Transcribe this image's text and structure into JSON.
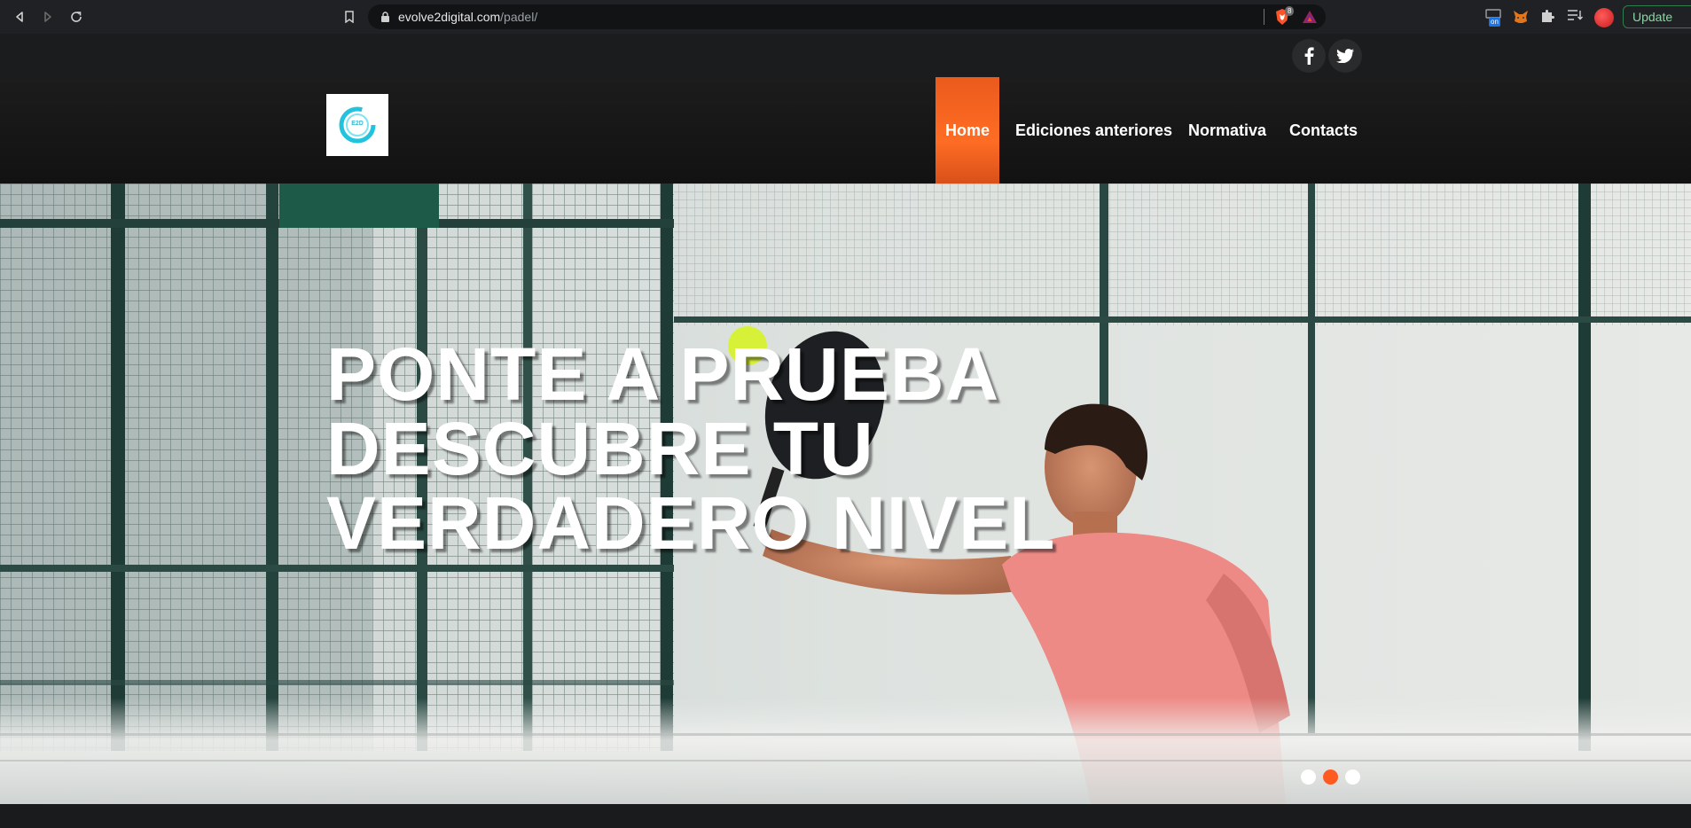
{
  "browser": {
    "url_domain": "evolve2digital.com",
    "url_path": "/padel/",
    "brave_badge_count": "8",
    "extension_on_label": "on",
    "update_label": "Update"
  },
  "site": {
    "logo_text": "E2D",
    "nav": [
      {
        "label": "Home",
        "active": true
      },
      {
        "label": "Ediciones anteriores",
        "active": false
      },
      {
        "label": "Normativa",
        "active": false
      },
      {
        "label": "Contacts",
        "active": false
      }
    ],
    "social": [
      "facebook-icon",
      "twitter-icon"
    ],
    "accent_color": "#ff5a1f"
  },
  "hero": {
    "title_line1": "PONTE A PRUEBA",
    "title_line2": "DESCUBRE TU",
    "title_line3": "VERDADERO NIVEL",
    "slides_total": 3,
    "active_slide": 2
  }
}
